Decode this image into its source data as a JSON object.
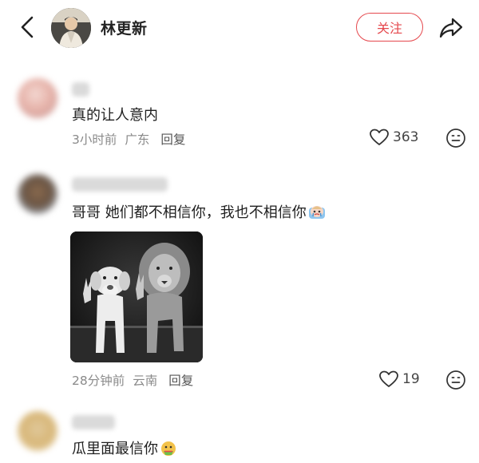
{
  "header": {
    "title": "林更新",
    "follow_label": "关注"
  },
  "comments": [
    {
      "text": "真的让人意内",
      "time": "3小时前",
      "location": "广东",
      "reply_label": "回复",
      "likes": "363"
    },
    {
      "text": "哥哥 她们都不相信你，我也不相信你",
      "time": "28分钟前",
      "location": "云南",
      "reply_label": "回复",
      "likes": "19"
    },
    {
      "text": "瓜里面最信你"
    }
  ]
}
